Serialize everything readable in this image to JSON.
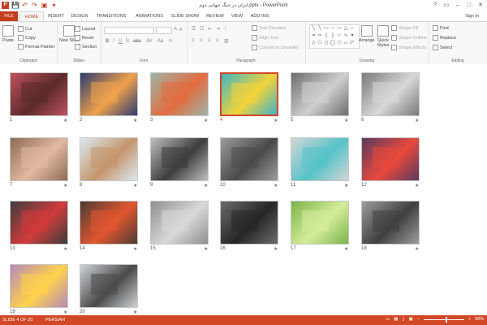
{
  "window": {
    "title": "ایران در جنگ جهانی دوم.pptx - PowerPoint",
    "controls": [
      "?",
      "▭",
      "–",
      "□",
      "✕"
    ]
  },
  "qat": [
    "P",
    "💾",
    "↶",
    "↷",
    "▣",
    "▾"
  ],
  "tabs": [
    "FILE",
    "HOME",
    "INSERT",
    "DESIGN",
    "TRANSITIONS",
    "ANIMATIONS",
    "SLIDE SHOW",
    "REVIEW",
    "VIEW",
    "ADD-INS"
  ],
  "active_tab": "HOME",
  "sign_in": "Sign in",
  "ribbon": {
    "clipboard": {
      "label": "Clipboard",
      "paste": "Paste",
      "cut": "Cut",
      "copy": "Copy",
      "format_painter": "Format Painter"
    },
    "slides": {
      "label": "Slides",
      "new_slide": "New Slide",
      "layout": "Layout",
      "reset": "Reset",
      "section": "Section"
    },
    "font": {
      "label": "Font"
    },
    "paragraph": {
      "label": "Paragraph",
      "text_direction": "Text Direction",
      "align_text": "Align Text",
      "smartart": "Convert to SmartArt"
    },
    "drawing": {
      "label": "Drawing",
      "arrange": "Arrange",
      "quick_styles": "Quick Styles",
      "shape_fill": "Shape Fill",
      "shape_outline": "Shape Outline",
      "shape_effects": "Shape Effects"
    },
    "editing": {
      "label": "Editing",
      "find": "Find",
      "replace": "Replace",
      "select": "Select"
    }
  },
  "slides": [
    {
      "n": "1",
      "bg": "#c0525f",
      "accent": "#5b2a2a"
    },
    {
      "n": "2",
      "bg": "#2d3b70",
      "accent": "#f0a24c"
    },
    {
      "n": "3",
      "bg": "#9fb5a8",
      "accent": "#e26c3f"
    },
    {
      "n": "4",
      "bg": "#3fb4c4",
      "accent": "#f2d33b"
    },
    {
      "n": "5",
      "bg": "#6d6d6d",
      "accent": "#cfcfcf"
    },
    {
      "n": "6",
      "bg": "#7a7a7a",
      "accent": "#d8d8d8"
    },
    {
      "n": "7",
      "bg": "#8c6c58",
      "accent": "#e2b8a0"
    },
    {
      "n": "8",
      "bg": "#dceaf2",
      "accent": "#c4956c"
    },
    {
      "n": "9",
      "bg": "#bfbfbf",
      "accent": "#3d3d3d"
    },
    {
      "n": "10",
      "bg": "#9c9c9c",
      "accent": "#4a4a4a"
    },
    {
      "n": "11",
      "bg": "#d5d5d5",
      "accent": "#55c3c9"
    },
    {
      "n": "12",
      "bg": "#5a3b62",
      "accent": "#e8493b"
    },
    {
      "n": "13",
      "bg": "#3d3d3d",
      "accent": "#d23b3b"
    },
    {
      "n": "14",
      "bg": "#4b3c33",
      "accent": "#e1562f"
    },
    {
      "n": "15",
      "bg": "#8f8f8f",
      "accent": "#d9d9d9"
    },
    {
      "n": "16",
      "bg": "#6c6c6c",
      "accent": "#262626"
    },
    {
      "n": "17",
      "bg": "#79b54a",
      "accent": "#d6ec9a"
    },
    {
      "n": "18",
      "bg": "#9e9e9e",
      "accent": "#3f3f3f"
    },
    {
      "n": "19",
      "bg": "#b78ab9",
      "accent": "#ffd24b"
    },
    {
      "n": "20",
      "bg": "#cfd4d8",
      "accent": "#4a4a4a"
    }
  ],
  "selected_slide": "4",
  "slide_star": "★",
  "status": {
    "slide_info": "SLIDE 4 OF 20",
    "language": "PERSIAN",
    "zoom": "58%"
  }
}
